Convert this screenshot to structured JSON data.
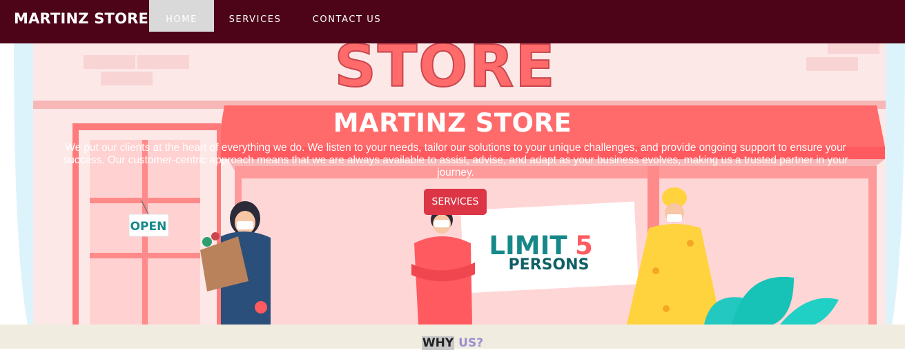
{
  "navbar": {
    "brand": "MARTINZ STORE",
    "items": [
      {
        "label": "HOME",
        "active": true
      },
      {
        "label": "SERVICES",
        "active": false
      },
      {
        "label": "CONTACT US",
        "active": false
      }
    ]
  },
  "hero": {
    "illustration": {
      "store_sign": "STORE",
      "door_sign": "OPEN",
      "notice_line1": "LIMIT",
      "notice_number": "5",
      "notice_line2": "PERSONS"
    },
    "title": "MARTINZ STORE",
    "text": "We put our clients at the heart of everything we do. We listen to your needs, tailor our solutions to your unique challenges, and provide ongoing support to ensure your success. Our customer-centric approach means that we are always available to assist, advise, and adapt as your business evolves, making us a trusted partner in your journey.",
    "button_label": "SERVICES"
  },
  "why": {
    "title_part1": "WHY",
    "title_part2": "US?"
  },
  "colors": {
    "navbar_bg": "#4d0419",
    "store_red": "#ff6b6b",
    "button_red": "#dc3545",
    "section_bg": "#f0ecdf",
    "accent_purple": "#9a8fd0"
  }
}
